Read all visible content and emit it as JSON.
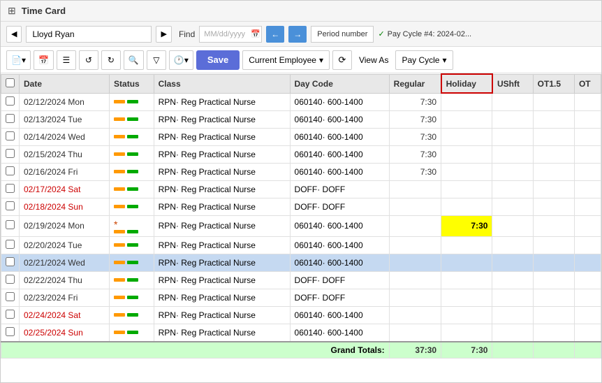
{
  "title": "Time Card",
  "toolbar_top": {
    "employee_name": "Lloyd Ryan",
    "find_label": "Find",
    "date_placeholder": "MM/dd/yyyy",
    "period_label": "Period number",
    "pay_cycle_info": "Pay Cycle #4: 2024-02...",
    "check_text": "✓"
  },
  "toolbar_bottom": {
    "save_label": "Save",
    "current_employee_label": "Current Employee",
    "view_as_label": "View As",
    "pay_cycle_label": "Pay Cycle"
  },
  "table": {
    "headers": [
      "",
      "Date",
      "Status",
      "Class",
      "Day Code",
      "Regular",
      "Holiday",
      "UShft",
      "OT1.5",
      "OT"
    ],
    "rows": [
      {
        "checked": false,
        "date": "02/12/2024 Mon",
        "weekend": false,
        "asterisk": false,
        "status": true,
        "class": "RPN· Reg Practical Nurse",
        "daycode": "060140· 600-1400",
        "regular": "7:30",
        "holiday": "",
        "ushft": "",
        "ot15": "",
        "selected": false
      },
      {
        "checked": false,
        "date": "02/13/2024 Tue",
        "weekend": false,
        "asterisk": false,
        "status": true,
        "class": "RPN· Reg Practical Nurse",
        "daycode": "060140· 600-1400",
        "regular": "7:30",
        "holiday": "",
        "ushft": "",
        "ot15": "",
        "selected": false
      },
      {
        "checked": false,
        "date": "02/14/2024 Wed",
        "weekend": false,
        "asterisk": false,
        "status": true,
        "class": "RPN· Reg Practical Nurse",
        "daycode": "060140· 600-1400",
        "regular": "7:30",
        "holiday": "",
        "ushft": "",
        "ot15": "",
        "selected": false
      },
      {
        "checked": false,
        "date": "02/15/2024 Thu",
        "weekend": false,
        "asterisk": false,
        "status": true,
        "class": "RPN· Reg Practical Nurse",
        "daycode": "060140· 600-1400",
        "regular": "7:30",
        "holiday": "",
        "ushft": "",
        "ot15": "",
        "selected": false
      },
      {
        "checked": false,
        "date": "02/16/2024 Fri",
        "weekend": false,
        "asterisk": false,
        "status": true,
        "class": "RPN· Reg Practical Nurse",
        "daycode": "060140· 600-1400",
        "regular": "7:30",
        "holiday": "",
        "ushft": "",
        "ot15": "",
        "selected": false
      },
      {
        "checked": false,
        "date": "02/17/2024 Sat",
        "weekend": true,
        "asterisk": false,
        "status": true,
        "class": "RPN· Reg Practical Nurse",
        "daycode": "DOFF· DOFF",
        "regular": "",
        "holiday": "",
        "ushft": "",
        "ot15": "",
        "selected": false
      },
      {
        "checked": false,
        "date": "02/18/2024 Sun",
        "weekend": true,
        "asterisk": false,
        "status": true,
        "class": "RPN· Reg Practical Nurse",
        "daycode": "DOFF· DOFF",
        "regular": "",
        "holiday": "",
        "ushft": "",
        "ot15": "",
        "selected": false
      },
      {
        "checked": false,
        "date": "02/19/2024 Mon",
        "weekend": false,
        "asterisk": true,
        "status": true,
        "class": "RPN· Reg Practical Nurse",
        "daycode": "060140· 600-1400",
        "regular": "",
        "holiday": "7:30",
        "ushft": "",
        "ot15": "",
        "selected": false,
        "holiday_highlight": true
      },
      {
        "checked": false,
        "date": "02/20/2024 Tue",
        "weekend": false,
        "asterisk": false,
        "status": true,
        "class": "RPN· Reg Practical Nurse",
        "daycode": "060140· 600-1400",
        "regular": "",
        "holiday": "",
        "ushft": "",
        "ot15": "",
        "selected": false
      },
      {
        "checked": false,
        "date": "02/21/2024 Wed",
        "weekend": false,
        "asterisk": false,
        "status": true,
        "class": "RPN· Reg Practical Nurse",
        "daycode": "060140· 600-1400",
        "regular": "",
        "holiday": "",
        "ushft": "",
        "ot15": "",
        "selected": true
      },
      {
        "checked": false,
        "date": "02/22/2024 Thu",
        "weekend": false,
        "asterisk": false,
        "status": true,
        "class": "RPN· Reg Practical Nurse",
        "daycode": "DOFF· DOFF",
        "regular": "",
        "holiday": "",
        "ushft": "",
        "ot15": "",
        "selected": false
      },
      {
        "checked": false,
        "date": "02/23/2024 Fri",
        "weekend": false,
        "asterisk": false,
        "status": true,
        "class": "RPN· Reg Practical Nurse",
        "daycode": "DOFF· DOFF",
        "regular": "",
        "holiday": "",
        "ushft": "",
        "ot15": "",
        "selected": false
      },
      {
        "checked": false,
        "date": "02/24/2024 Sat",
        "weekend": true,
        "asterisk": false,
        "status": true,
        "class": "RPN· Reg Practical Nurse",
        "daycode": "060140· 600-1400",
        "regular": "",
        "holiday": "",
        "ushft": "",
        "ot15": "",
        "selected": false
      },
      {
        "checked": false,
        "date": "02/25/2024 Sun",
        "weekend": true,
        "asterisk": false,
        "status": true,
        "class": "RPN· Reg Practical Nurse",
        "daycode": "060140· 600-1400",
        "regular": "",
        "holiday": "",
        "ushft": "",
        "ot15": "",
        "selected": false
      }
    ],
    "grand_totals": {
      "label": "Grand Totals:",
      "regular": "37:30",
      "holiday": "7:30"
    }
  }
}
